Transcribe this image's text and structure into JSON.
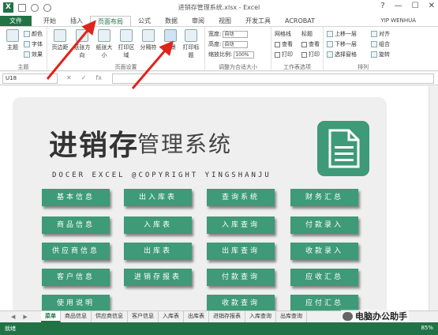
{
  "window": {
    "title": "进销存管理系统.xlsx - Excel",
    "user": "YIP WENHUA",
    "controls": [
      "?",
      "—",
      "☐",
      "✕"
    ]
  },
  "tabs": [
    "文件",
    "开始",
    "插入",
    "页面布局",
    "公式",
    "数据",
    "审阅",
    "视图",
    "开发工具",
    "ACROBAT"
  ],
  "ribbon": {
    "themes": {
      "big": "主题",
      "small": [
        "颜色",
        "字体",
        "效果"
      ],
      "label": "主题"
    },
    "page_setup": {
      "buttons": [
        "页边距",
        "纸张方向",
        "纸张大小",
        "打印区域",
        "分隔符",
        "背景",
        "打印标题"
      ],
      "label": "页面设置"
    },
    "scale": {
      "rows": [
        {
          "name": "宽度:",
          "value": "自动"
        },
        {
          "name": "高度:",
          "value": "自动"
        },
        {
          "name": "缩放比例:",
          "value": "100%"
        }
      ],
      "label": "调整为合适大小"
    },
    "sheet_options": {
      "cols": [
        "网格线",
        "标题"
      ],
      "rows": [
        "查看",
        "打印"
      ],
      "label": "工作表选项"
    },
    "arrange": {
      "items": [
        "上移一层",
        "下移一层",
        "选择窗格",
        "对齐",
        "组合",
        "旋转"
      ],
      "label": "排列"
    }
  },
  "formula_bar": {
    "namebox": "U18",
    "icons": [
      "✕",
      "✓",
      "fx"
    ],
    "value": ""
  },
  "dashboard": {
    "title_big": "进销存",
    "title_rest": "管理系统",
    "subtitle": "DOCER EXCEL @COPYRIGHT YINGSHANJU",
    "buttons": [
      [
        "基本信息",
        "出入库表",
        "查询系统",
        "财务汇总"
      ],
      [
        "商品信息",
        "入库表",
        "入库查询",
        "付款录入"
      ],
      [
        "供应商信息",
        "出库表",
        "出库查询",
        "收款录入"
      ],
      [
        "客户信息",
        "进销存报表",
        "付款查询",
        "应收汇总"
      ],
      [
        "使用说明",
        "",
        "收款查询",
        "应付汇总"
      ]
    ]
  },
  "sheet_tabs": [
    "菜单",
    "商品信息",
    "供应商信息",
    "客户信息",
    "入库表",
    "出库表",
    "进销存报表",
    "入库查询",
    "出库查询"
  ],
  "status": {
    "ready": "就绪",
    "zoom": "85%"
  },
  "watermark": "电脑办公助手",
  "colors": {
    "excel_green": "#217346",
    "button_teal": "#3e9a78",
    "arrow_red": "#e0241b"
  }
}
